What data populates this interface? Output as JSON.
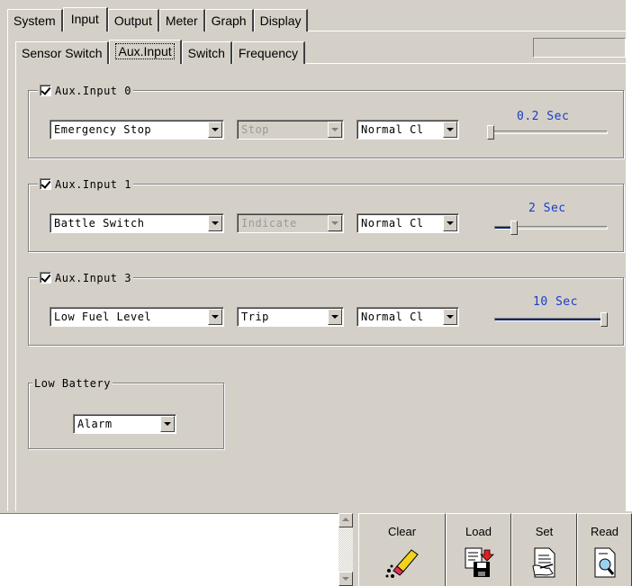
{
  "tabs_top": [
    {
      "label": "System"
    },
    {
      "label": "Input"
    },
    {
      "label": "Output"
    },
    {
      "label": "Meter"
    },
    {
      "label": "Graph"
    },
    {
      "label": "Display"
    }
  ],
  "tabs_sub": [
    {
      "label": "Sensor Switch"
    },
    {
      "label": "Aux.Input"
    },
    {
      "label": "Switch"
    },
    {
      "label": "Frequency"
    }
  ],
  "groups": [
    {
      "title": "Aux.Input 0",
      "checked": true,
      "function": "Emergency Stop",
      "action": "Stop",
      "action_disabled": true,
      "contact": "Normal Cl",
      "delay_label": "0.2 Sec",
      "delay_fraction": 0.0
    },
    {
      "title": "Aux.Input 1",
      "checked": true,
      "function": "Battle Switch",
      "action": "Indicate",
      "action_disabled": true,
      "contact": "Normal Cl",
      "delay_label": "2 Sec",
      "delay_fraction": 0.15
    },
    {
      "title": "Aux.Input 3",
      "checked": true,
      "function": "Low Fuel Level",
      "action": "Trip",
      "action_disabled": false,
      "contact": "Normal Cl",
      "delay_label": "10 Sec",
      "delay_fraction": 1.0
    }
  ],
  "low_battery": {
    "title": "Low Battery",
    "value": "Alarm"
  },
  "buttons": {
    "clear": "Clear",
    "load": "Load",
    "set": "Set",
    "read": "Read"
  },
  "icons": {
    "clear": "eraser-icon",
    "load": "load-disk-icon",
    "set": "set-document-icon",
    "read": "read-document-icon"
  },
  "colors": {
    "window": "#d4d0c8",
    "slider_label": "#1a3cc8",
    "slider_fill": "#0a246a"
  }
}
